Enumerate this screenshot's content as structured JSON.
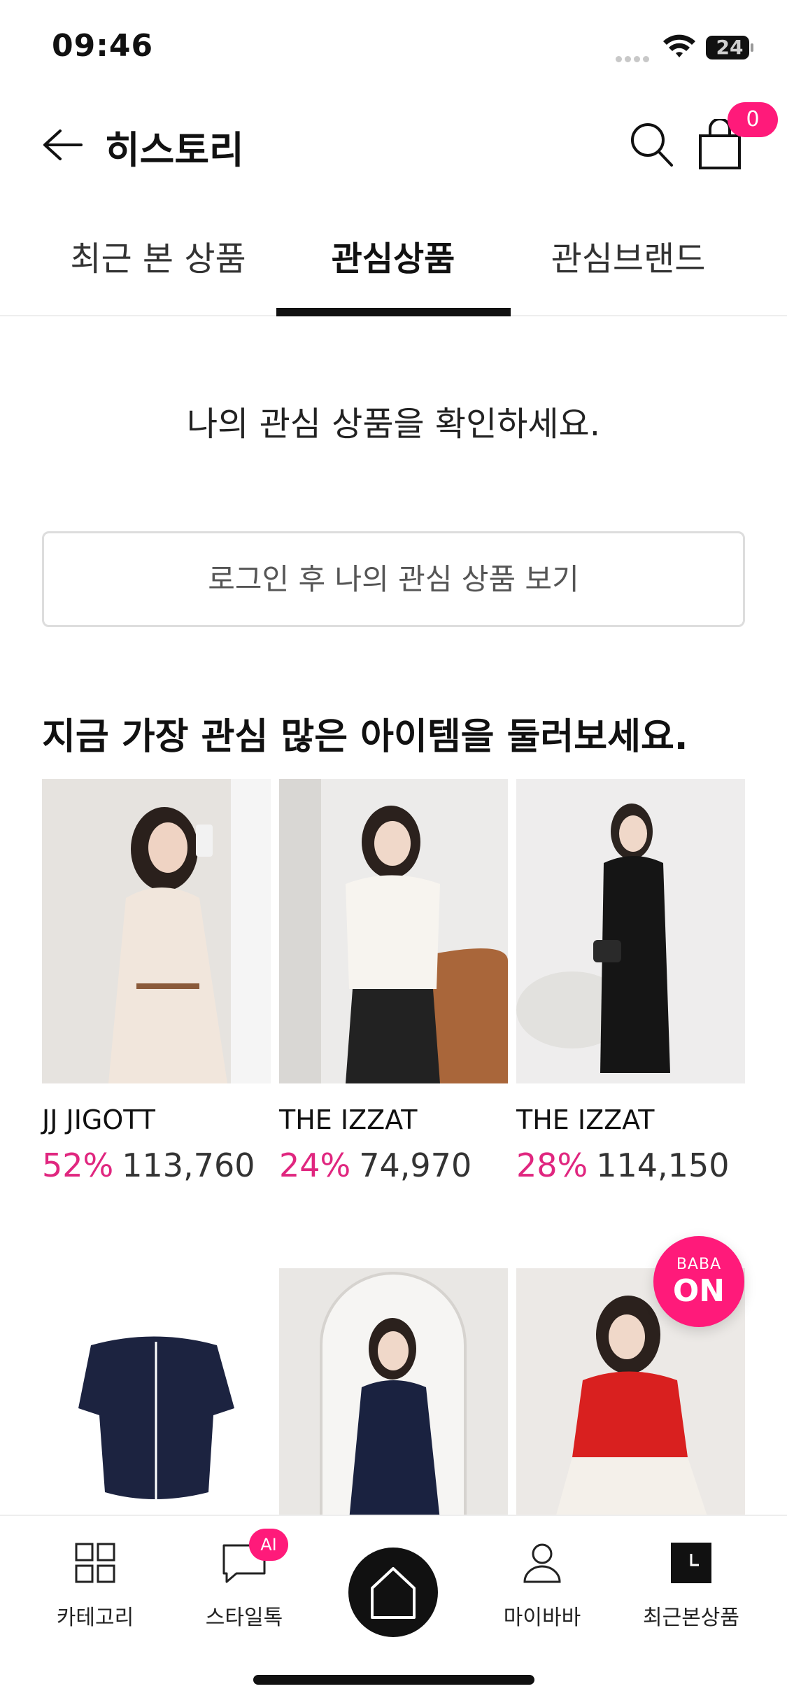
{
  "status_bar": {
    "time": "09:46",
    "battery": "24"
  },
  "header": {
    "title": "히스토리",
    "cart_count": "0"
  },
  "tabs": [
    {
      "label": "최근 본 상품",
      "active": false
    },
    {
      "label": "관심상품",
      "active": true
    },
    {
      "label": "관심브랜드",
      "active": false
    }
  ],
  "notice": {
    "text": "나의 관심 상품을 확인하세요.",
    "login_button": "로그인 후 나의 관심 상품 보기"
  },
  "recommend": {
    "title": "지금 가장 관심 많은 아이템을 둘러보세요.",
    "products": [
      {
        "brand": "JJ JIGOTT",
        "discount": "52%",
        "price": "113,760"
      },
      {
        "brand": "THE IZZAT",
        "discount": "24%",
        "price": "74,970"
      },
      {
        "brand": "THE IZZAT",
        "discount": "28%",
        "price": "114,150"
      }
    ]
  },
  "floating": {
    "line1": "BABA",
    "line2": "ON"
  },
  "bottom_nav": {
    "items": [
      "카테고리",
      "스타일톡",
      "마이바바",
      "최근본상품"
    ],
    "ai_badge": "AI"
  },
  "colors": {
    "accent": "#ff1a7a",
    "discount": "#e0267f"
  }
}
